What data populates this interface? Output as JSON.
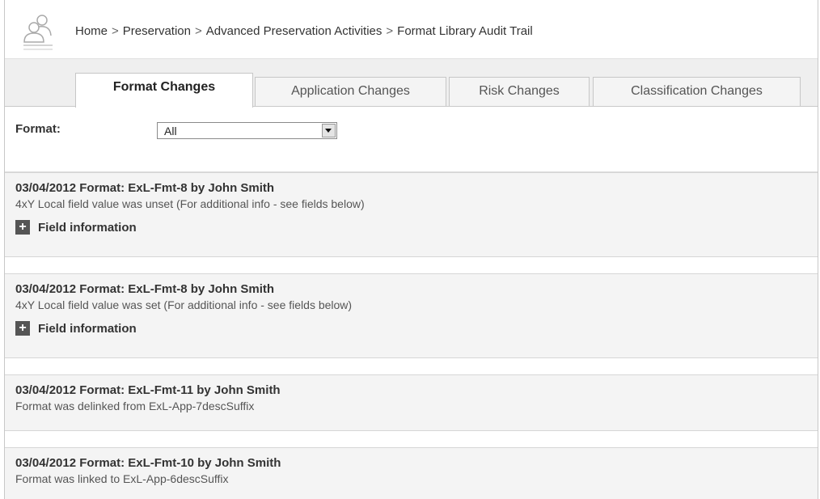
{
  "breadcrumb": {
    "items": [
      "Home",
      "Preservation",
      "Advanced Preservation Activities",
      "Format Library Audit Trail"
    ],
    "separator": ">"
  },
  "tabs": [
    {
      "label": "Format Changes",
      "active": true
    },
    {
      "label": "Application Changes",
      "active": false
    },
    {
      "label": "Risk Changes",
      "active": false
    },
    {
      "label": "Classification Changes",
      "active": false
    }
  ],
  "filter": {
    "label": "Format:",
    "value": "All"
  },
  "entries": [
    {
      "title": "03/04/2012 Format: ExL-Fmt-8 by John Smith",
      "description": "4xY Local field value was unset (For additional info - see fields below)",
      "field_info_label": "Field information",
      "toggle_symbol": "+"
    },
    {
      "title": "03/04/2012 Format: ExL-Fmt-8 by John Smith",
      "description": "4xY Local field value was set (For additional info - see fields below)",
      "field_info_label": "Field information",
      "toggle_symbol": "+"
    },
    {
      "title": "03/04/2012 Format: ExL-Fmt-11 by John Smith",
      "description": "Format was delinked from ExL-App-7descSuffix"
    },
    {
      "title": "03/04/2012 Format: ExL-Fmt-10 by John Smith",
      "description": "Format was linked to ExL-App-6descSuffix"
    }
  ],
  "icons": {
    "logo": "users-icon",
    "toggle": "plus-icon",
    "dropdown": "chevron-down-icon"
  },
  "colors": {
    "tab_bar_bg": "#efefef",
    "entry_bg": "#f4f4f4",
    "toggle_bg": "#555555"
  }
}
